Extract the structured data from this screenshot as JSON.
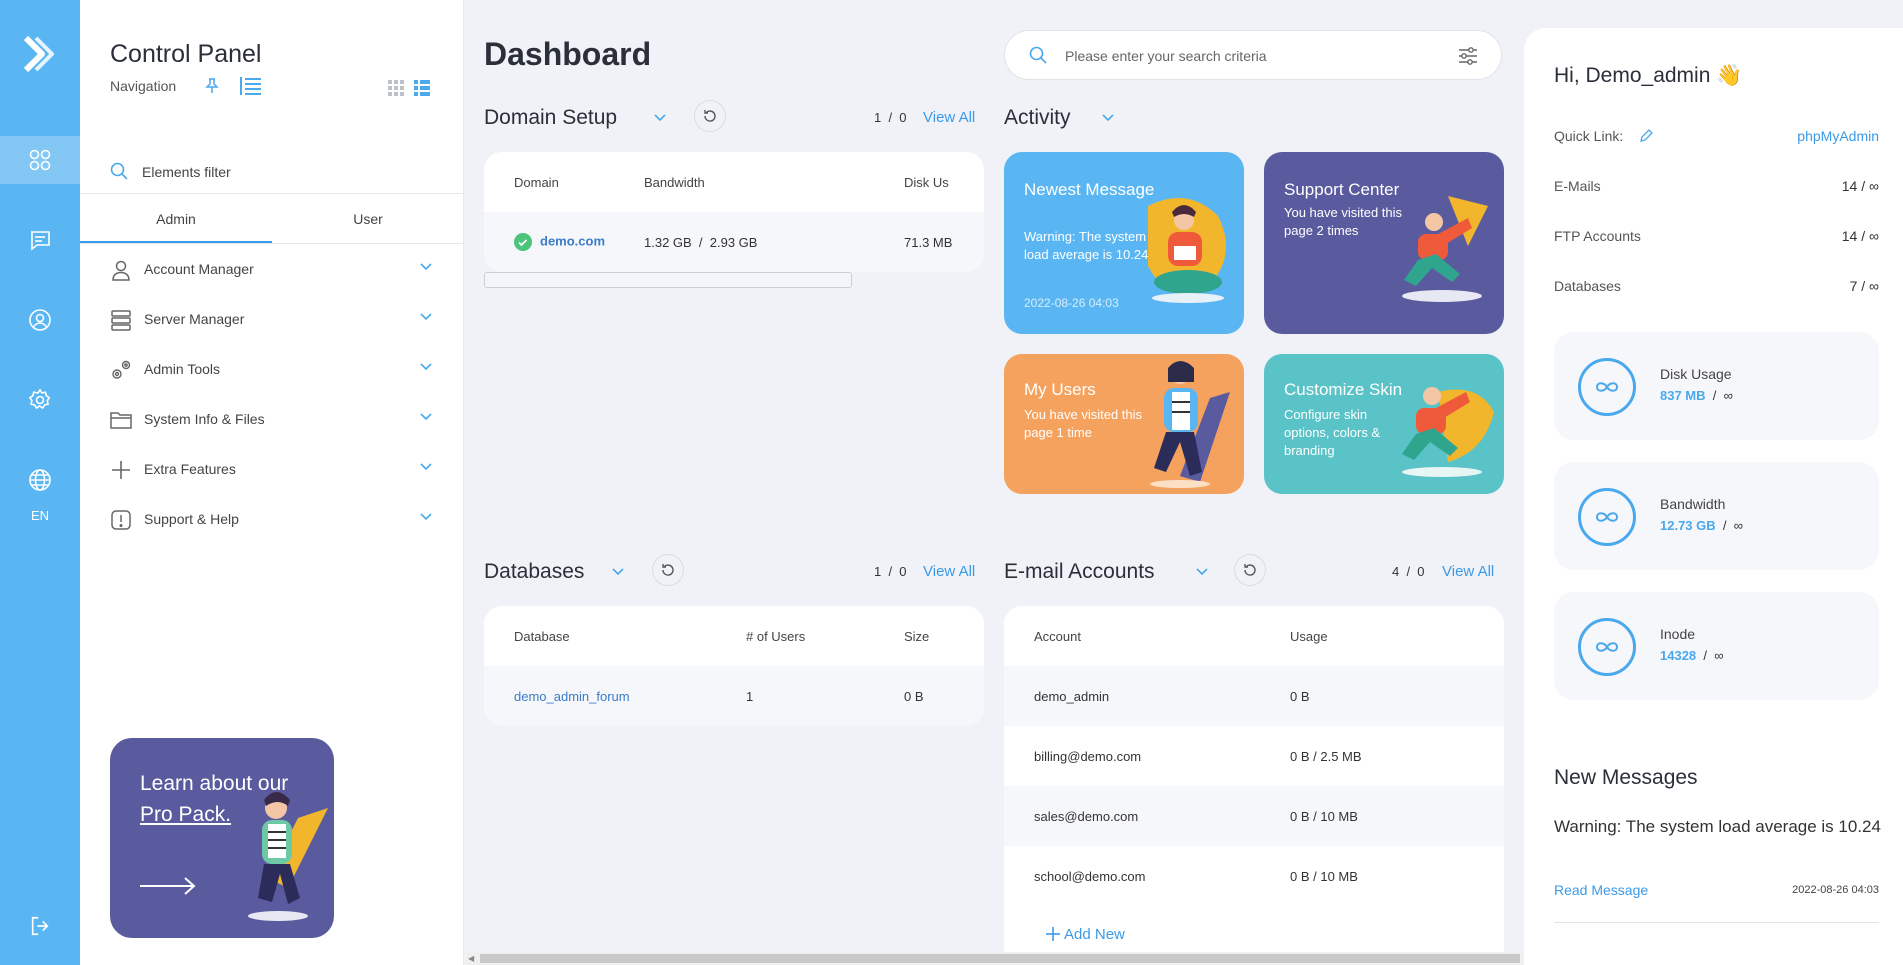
{
  "rail": {
    "language": "EN"
  },
  "nav": {
    "title": "Control Panel",
    "subtitle": "Navigation",
    "filter_placeholder": "Elements filter",
    "tabs": [
      "Admin",
      "User"
    ],
    "items": [
      {
        "label": "Account Manager",
        "icon": "user-icon"
      },
      {
        "label": "Server Manager",
        "icon": "server-icon"
      },
      {
        "label": "Admin Tools",
        "icon": "gears-icon"
      },
      {
        "label": "System Info & Files",
        "icon": "folder-icon"
      },
      {
        "label": "Extra Features",
        "icon": "plus-icon"
      },
      {
        "label": "Support & Help",
        "icon": "alert-icon"
      }
    ],
    "promo": {
      "line1": "Learn about our",
      "line2": "Pro Pack."
    }
  },
  "main": {
    "title": "Dashboard",
    "search_placeholder": "Please enter your search criteria",
    "domain_setup": {
      "title": "Domain Setup",
      "count_a": "1",
      "count_b": "0",
      "view_all": "View All",
      "columns": [
        "Domain",
        "Bandwidth",
        "Disk Us"
      ],
      "rows": [
        {
          "domain": "demo.com",
          "bw_used": "1.32 GB",
          "bw_limit": "2.93 GB",
          "disk": "71.3 MB"
        }
      ]
    },
    "activity": {
      "title": "Activity",
      "cards": [
        {
          "title": "Newest Message",
          "desc": "Warning: The system load average is 10.24",
          "time": "2022-08-26 04:03",
          "color": "#5ab6f2"
        },
        {
          "title": "Support Center",
          "desc": "You have visited this page 2 times",
          "color": "#5a5a9e"
        },
        {
          "title": "My Users",
          "desc": "You have visited this page 1 time",
          "color": "#f5a25f"
        },
        {
          "title": "Customize Skin",
          "desc": "Configure skin options, colors & branding",
          "color": "#5ac3c8"
        }
      ]
    },
    "databases": {
      "title": "Databases",
      "count_a": "1",
      "count_b": "0",
      "view_all": "View All",
      "columns": [
        "Database",
        "# of Users",
        "Size"
      ],
      "rows": [
        {
          "name": "demo_admin_forum",
          "users": "1",
          "size": "0 B"
        }
      ]
    },
    "email": {
      "title": "E-mail Accounts",
      "count_a": "4",
      "count_b": "0",
      "view_all": "View All",
      "columns": [
        "Account",
        "Usage"
      ],
      "rows": [
        {
          "account": "demo_admin",
          "usage": "0 B"
        },
        {
          "account": "billing@demo.com",
          "usage": "0 B / 2.5 MB"
        },
        {
          "account": "sales@demo.com",
          "usage": "0 B / 10 MB"
        },
        {
          "account": "school@demo.com",
          "usage": "0 B / 10 MB"
        }
      ],
      "add_new": "Add New"
    }
  },
  "right": {
    "greeting": "Hi, Demo_admin",
    "greeting_emoji": "👋",
    "quick_link_label": "Quick Link:",
    "quick_link_value": "phpMyAdmin",
    "stats": [
      {
        "label": "E-Mails",
        "value": "14 / ∞"
      },
      {
        "label": "FTP Accounts",
        "value": "14 / ∞"
      },
      {
        "label": "Databases",
        "value": "7 / ∞"
      }
    ],
    "usage": [
      {
        "label": "Disk Usage",
        "used": "837 MB",
        "limit": "∞"
      },
      {
        "label": "Bandwidth",
        "used": "12.73 GB",
        "limit": "∞"
      },
      {
        "label": "Inode",
        "used": "14328",
        "limit": "∞"
      }
    ],
    "new_messages": {
      "title": "New Messages",
      "message": "Warning: The system load average is 10.24",
      "read": "Read Message",
      "date": "2022-08-26 04:03"
    }
  }
}
